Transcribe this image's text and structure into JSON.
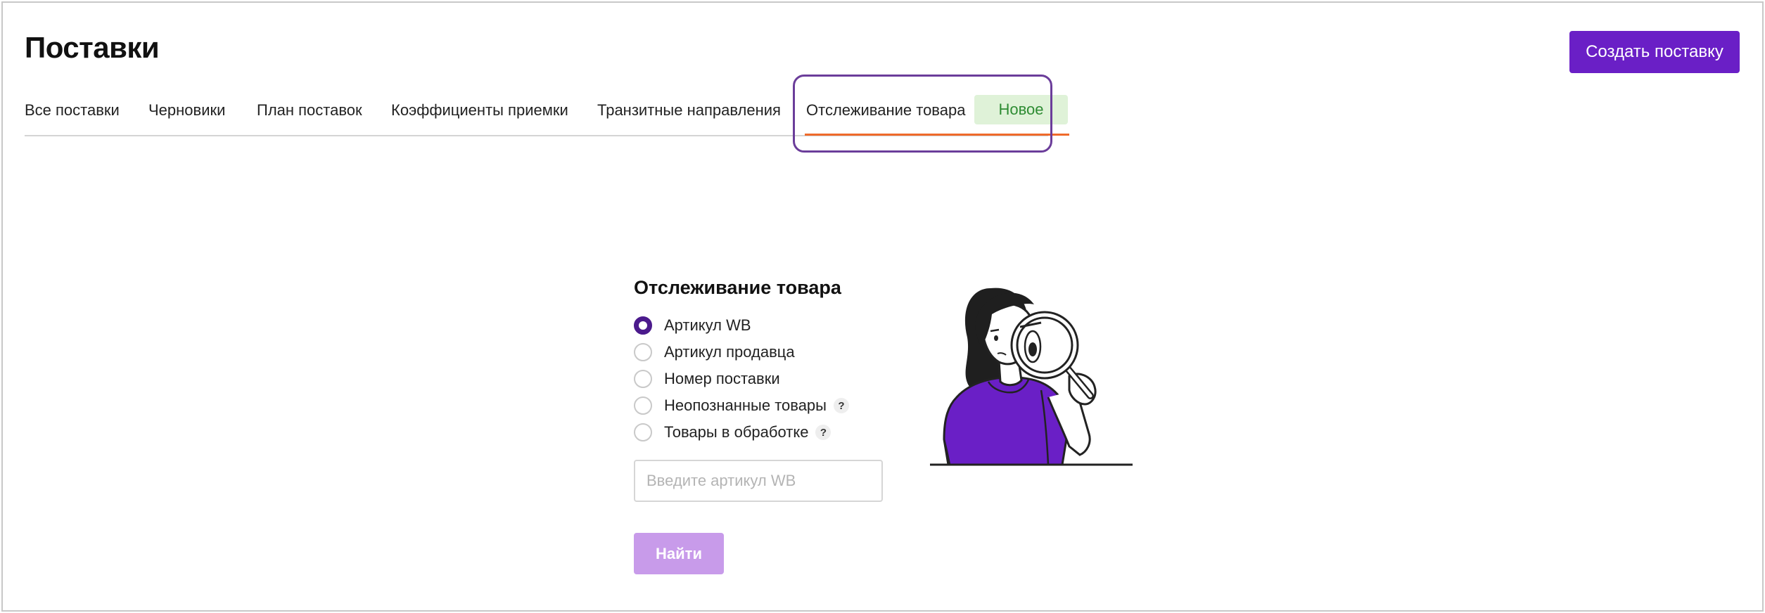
{
  "header": {
    "title": "Поставки",
    "create_button": "Создать поставку"
  },
  "tabs": [
    {
      "label": "Все поставки"
    },
    {
      "label": "Черновики"
    },
    {
      "label": "План поставок"
    },
    {
      "label": "Коэффициенты приемки"
    },
    {
      "label": "Транзитные направления"
    },
    {
      "label": "Отслеживание товара",
      "active": true,
      "badge": "Новое"
    }
  ],
  "tracking": {
    "title": "Отслеживание товара",
    "options": [
      {
        "label": "Артикул WB",
        "checked": true
      },
      {
        "label": "Артикул продавца",
        "checked": false
      },
      {
        "label": "Номер поставки",
        "checked": false
      },
      {
        "label": "Неопознанные товары",
        "checked": false,
        "help": "?"
      },
      {
        "label": "Товары в обработке",
        "checked": false,
        "help": "?"
      }
    ],
    "input_placeholder": "Введите артикул WB",
    "input_value": "",
    "find_button": "Найти"
  },
  "colors": {
    "accent": "#6a1fc6",
    "radio_checked": "#4b1a8c",
    "tab_underline": "#ef6a2b",
    "badge_bg": "#dff2d8",
    "badge_text": "#2e8c33",
    "disabled_button": "#c89bea",
    "highlight_outline": "#6b3d9a",
    "illustration_shirt": "#6a1fc6"
  },
  "icons": {
    "illustration": "woman-with-magnifying-glass",
    "help": "question-mark-icon"
  }
}
